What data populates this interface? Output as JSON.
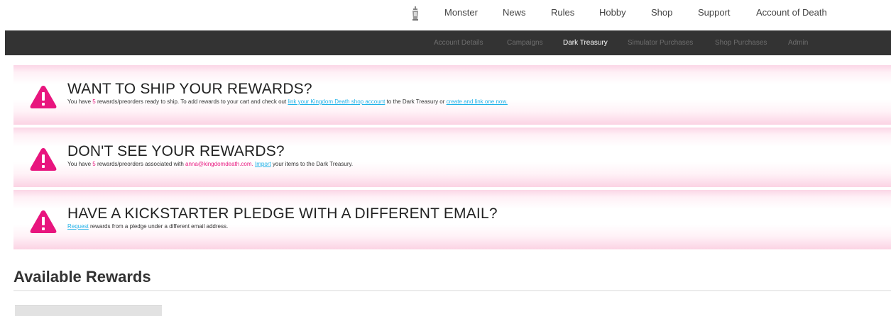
{
  "topnav": {
    "logo_icon": "kingdom-death-lantern-icon",
    "links": [
      "Monster",
      "News",
      "Rules",
      "Hobby",
      "Shop",
      "Support",
      "Account of Death"
    ]
  },
  "subnav": {
    "links": [
      "Account Details",
      "Campaigns",
      "Dark Treasury",
      "Simulator Purchases",
      "Shop Purchases",
      "Admin"
    ],
    "active": "Dark Treasury"
  },
  "banners": [
    {
      "title": "WANT TO SHIP YOUR REWARDS?",
      "body": {
        "t1": "You have ",
        "count": "5",
        "t2": " rewards/preorders ready to ship. To add rewards to your cart and check out ",
        "link1": "link your Kingdom Death shop account",
        "t3": " to the Dark Treasury or ",
        "link2": "create and link one now."
      }
    },
    {
      "title": "DON'T SEE YOUR REWARDS?",
      "body": {
        "t1": "You have ",
        "count": "5",
        "t2": " rewards/preorders associated with ",
        "email": "anna@kingdomdeath.com.",
        "link": "Import",
        "t3": " your items to the Dark Treasury."
      }
    },
    {
      "title": "HAVE A KICKSTARTER PLEDGE WITH A DIFFERENT EMAIL?",
      "body": {
        "link": "Request",
        "t1": " rewards from a pledge under a different email address."
      }
    }
  ],
  "section": {
    "title": "Available Rewards"
  },
  "colors": {
    "accent": "#e8157e",
    "link": "#1fb2e8",
    "subnav_bg": "#333333"
  }
}
